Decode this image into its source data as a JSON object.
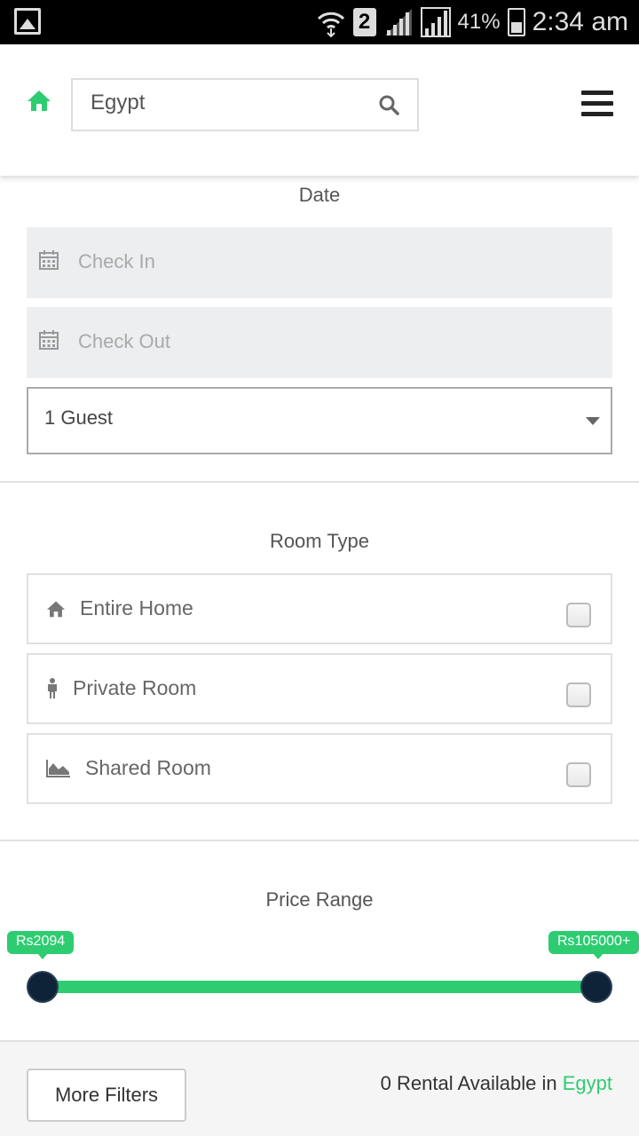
{
  "status_bar": {
    "sim": "2",
    "battery": "41%",
    "time": "2:34 am"
  },
  "header": {
    "search_value": "Egypt"
  },
  "date_section": {
    "title": "Date",
    "check_in_placeholder": "Check In",
    "check_out_placeholder": "Check Out",
    "guests_selected": "1 Guest"
  },
  "room_type": {
    "title": "Room Type",
    "options": [
      {
        "label": "Entire Home",
        "icon": "home-icon",
        "checked": false
      },
      {
        "label": "Private Room",
        "icon": "person-icon",
        "checked": false
      },
      {
        "label": "Shared Room",
        "icon": "area-chart-icon",
        "checked": false
      }
    ]
  },
  "price_range": {
    "title": "Price Range",
    "min_label": "Rs2094",
    "max_label": "Rs105000+"
  },
  "footer": {
    "more_filters": "More Filters",
    "available_prefix": "0 Rental Available in",
    "available_location": "Egypt"
  },
  "colors": {
    "accent": "#2ecc71",
    "handle": "#0e2238"
  }
}
